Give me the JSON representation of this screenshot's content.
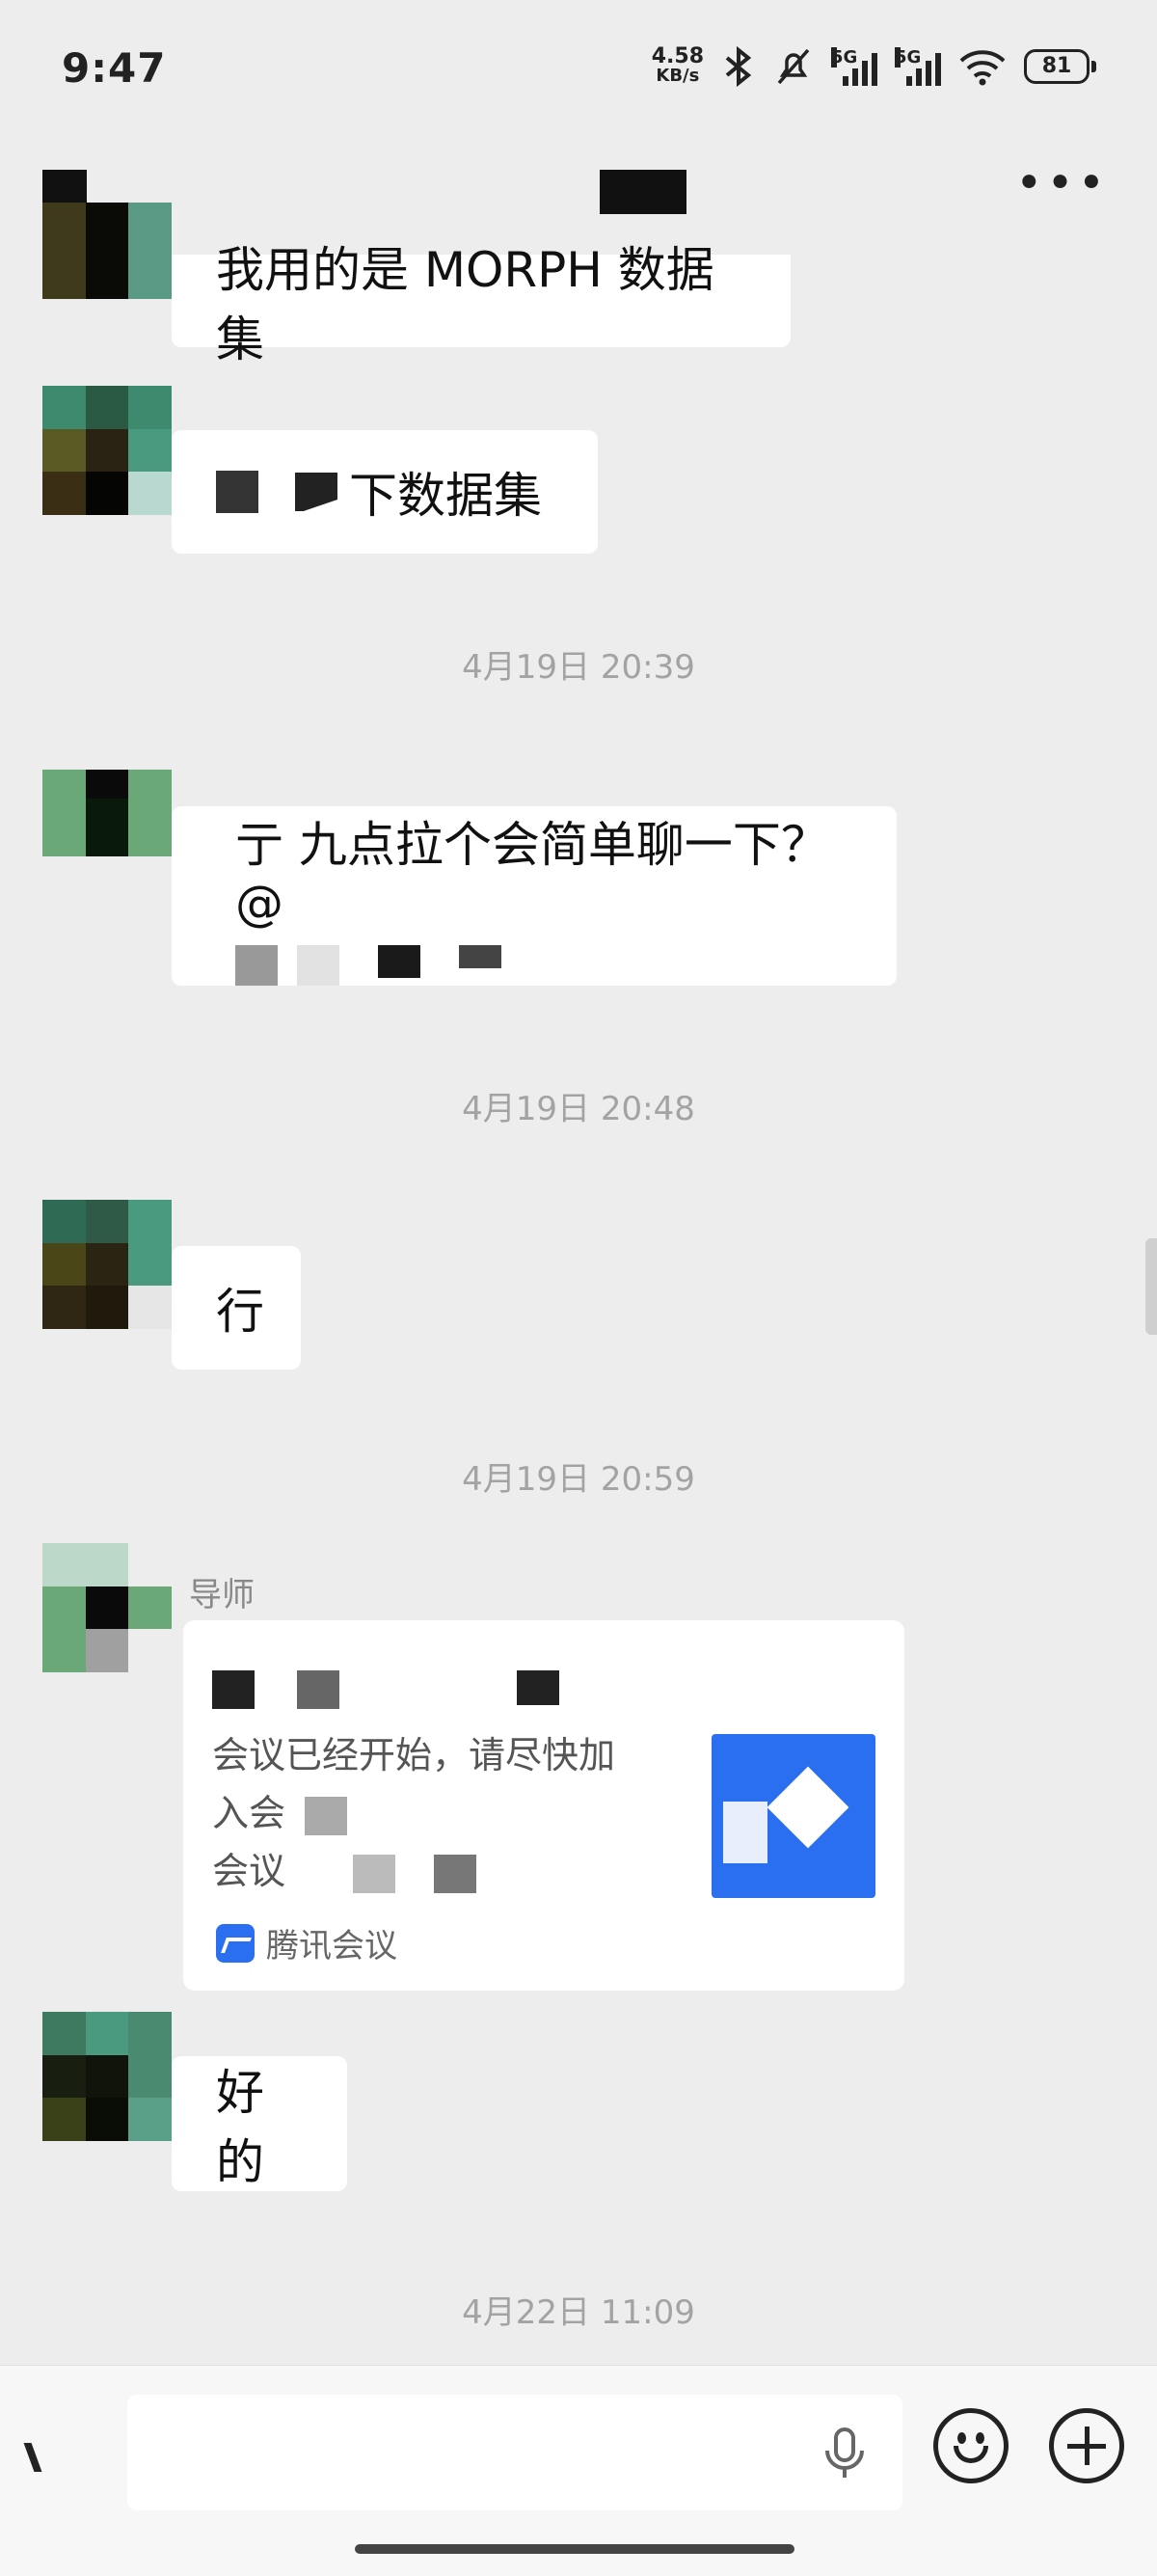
{
  "status_bar": {
    "time": "9:47",
    "net_speed_value": "4.58",
    "net_speed_unit": "KB/s",
    "signal1_label": "5G",
    "signal2_label": "5G",
    "battery": "81"
  },
  "chat": {
    "messages": [
      {
        "text": "我用的是 MORPH 数据集"
      },
      {
        "text": "下数据集"
      },
      {
        "text": "亍 九点拉个会简单聊一下？@"
      },
      {
        "text": "行"
      },
      {
        "text": "好的"
      }
    ],
    "timestamps": [
      "4月19日 20:39",
      "4月19日 20:48",
      "4月19日 20:59",
      "4月22日 11:09"
    ],
    "sender_name": "导师",
    "meeting_card": {
      "description_line1": "会议已经开始，请尽快加",
      "description_line2": "入会",
      "description_line3": "会议",
      "source": "腾讯会议"
    }
  }
}
